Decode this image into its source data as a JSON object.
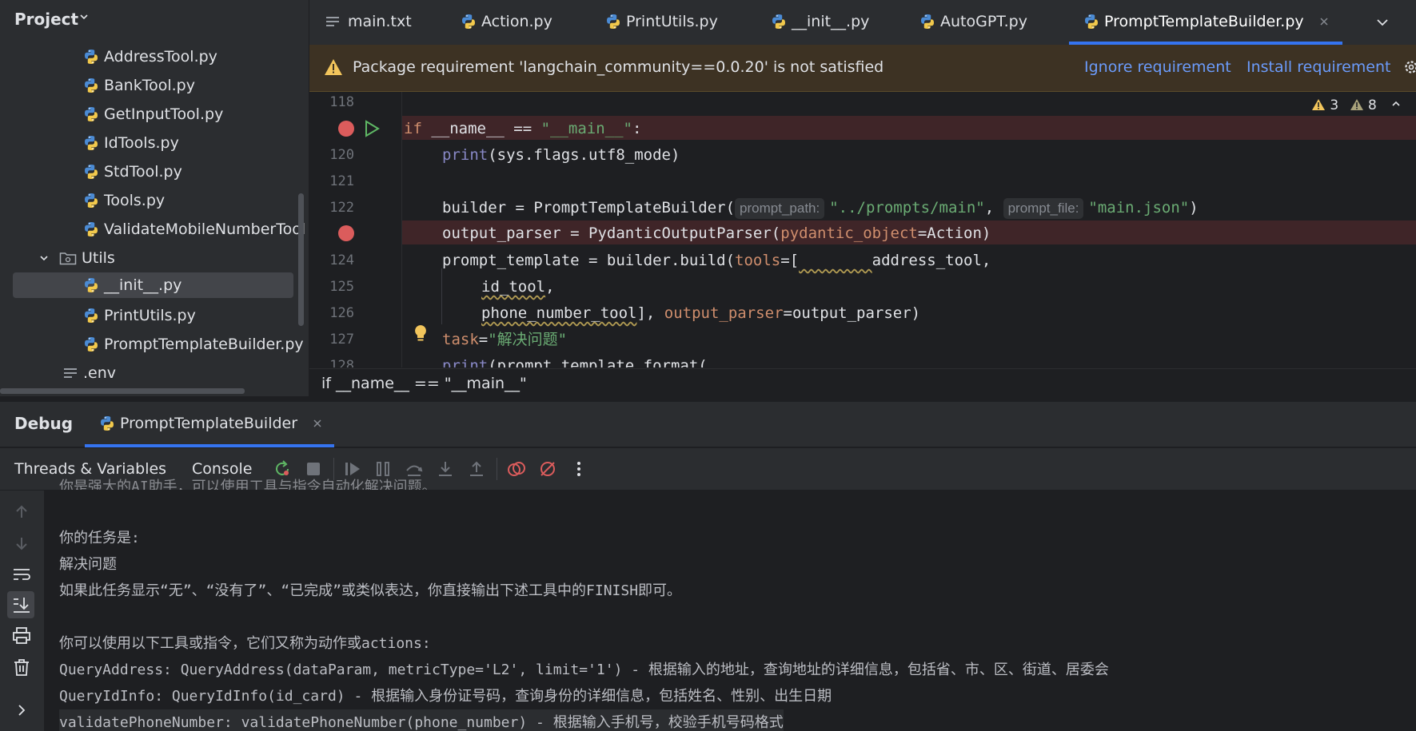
{
  "project": {
    "title": "Project",
    "files": [
      {
        "name": "AddressTool.py"
      },
      {
        "name": "BankTool.py"
      },
      {
        "name": "GetInputTool.py"
      },
      {
        "name": "IdTools.py"
      },
      {
        "name": "StdTool.py"
      },
      {
        "name": "Tools.py"
      },
      {
        "name": "ValidateMobileNumberTool"
      }
    ],
    "utils_folder": "Utils",
    "utils_files": [
      {
        "name": "__init__.py"
      },
      {
        "name": "PrintUtils.py"
      },
      {
        "name": "PromptTemplateBuilder.py"
      }
    ],
    "env_file": ".env"
  },
  "tabs": [
    {
      "label": "main.txt"
    },
    {
      "label": "Action.py"
    },
    {
      "label": "PrintUtils.py"
    },
    {
      "label": "__init__.py"
    },
    {
      "label": "AutoGPT.py"
    },
    {
      "label": "PromptTemplateBuilder.py"
    }
  ],
  "banner": {
    "text": "Package requirement 'langchain_community==0.0.20' is not satisfied",
    "ignore": "Ignore requirement",
    "install": "Install requirement"
  },
  "editor": {
    "line_numbers": [
      "118",
      "120",
      "121",
      "122",
      "124",
      "125",
      "126",
      "127",
      "128"
    ],
    "hint_prompt_path": "prompt_path:",
    "hint_prompt_file": "prompt_file:",
    "warnings_count": "3",
    "weak_warnings_count": "8"
  },
  "breadcrumb": "if __name__ == \"__main__\"",
  "debug": {
    "title": "Debug",
    "session": "PromptTemplateBuilder",
    "threads_tab": "Threads & Variables",
    "console_tab": "Console"
  },
  "console": {
    "lines": [
      "你的任务是:",
      "解决问题",
      "如果此任务显示“无”、“没有了”、“已完成”或类似表达，你直接输出下述工具中的FINISH即可。",
      "",
      "你可以使用以下工具或指令，它们又称为动作或actions:",
      "QueryAddress: QueryAddress(dataParam, metricType='L2', limit='1') - 根据输入的地址，查询地址的详细信息，包括省、市、区、街道、居委会",
      "QueryIdInfo: QueryIdInfo(id_card) - 根据输入身份证号码，查询身份的详细信息，包括姓名、性别、出生日期",
      "validatePhoneNumber: validatePhoneNumber(phone_number) - 根据输入手机号，校验手机号码格式"
    ]
  },
  "colors": {
    "accent": "#3574f0",
    "breakpoint": "#db5c5c",
    "warning": "#f2c55c"
  }
}
